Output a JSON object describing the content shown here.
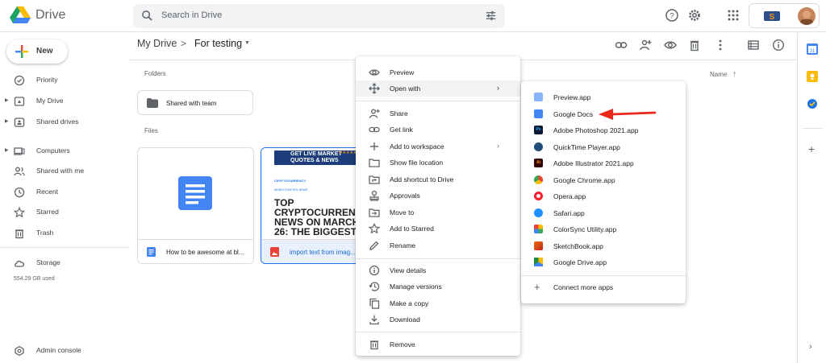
{
  "app": {
    "name": "Drive"
  },
  "search": {
    "placeholder": "Search in Drive"
  },
  "sidebar": {
    "new_label": "New",
    "items": [
      {
        "label": "Priority"
      },
      {
        "label": "My Drive"
      },
      {
        "label": "Shared drives"
      },
      {
        "label": "Computers"
      },
      {
        "label": "Shared with me"
      },
      {
        "label": "Recent"
      },
      {
        "label": "Starred"
      },
      {
        "label": "Trash"
      },
      {
        "label": "Storage"
      }
    ],
    "storage_used": "554.29 GB used",
    "admin_console": "Admin console"
  },
  "breadcrumb": {
    "root": "My Drive",
    "sep": ">",
    "current": "For testing"
  },
  "sections": {
    "folders": "Folders",
    "files": "Files",
    "sort_label": "Name"
  },
  "folders": [
    {
      "name": "Shared with team"
    }
  ],
  "files": [
    {
      "name": "How to be awesome at bl..."
    },
    {
      "name": "import text from imag..."
    }
  ],
  "thumb": {
    "banner": "GET LIVE MARKET QUOTES & NEWS",
    "line1": "CRYPTOCURRENCY",
    "line2": "MONEYCONTROL NEWS",
    "headline": "TOP CRYPTOCURRENCY NEWS ON MARCH 26: THE BIGGEST"
  },
  "context_menu": {
    "items": [
      {
        "label": "Preview",
        "icon": "eye-icon"
      },
      {
        "label": "Open with",
        "icon": "move-icon",
        "submenu": true
      },
      {
        "label": "Share",
        "icon": "person-add-icon"
      },
      {
        "label": "Get link",
        "icon": "link-icon"
      },
      {
        "label": "Add to workspace",
        "icon": "plus-icon",
        "submenu": true
      },
      {
        "label": "Show file location",
        "icon": "folder-icon"
      },
      {
        "label": "Add shortcut to Drive",
        "icon": "shortcut-icon"
      },
      {
        "label": "Approvals",
        "icon": "approval-icon"
      },
      {
        "label": "Move to",
        "icon": "move-to-icon"
      },
      {
        "label": "Add to Starred",
        "icon": "star-icon"
      },
      {
        "label": "Rename",
        "icon": "pencil-icon"
      },
      {
        "label": "View details",
        "icon": "info-icon"
      },
      {
        "label": "Manage versions",
        "icon": "history-icon"
      },
      {
        "label": "Make a copy",
        "icon": "copy-icon"
      },
      {
        "label": "Download",
        "icon": "download-icon"
      },
      {
        "label": "Remove",
        "icon": "trash-icon"
      }
    ]
  },
  "open_with_menu": {
    "items": [
      {
        "label": "Preview.app",
        "color": "#8ab4f8"
      },
      {
        "label": "Google Docs",
        "color": "#4285f4"
      },
      {
        "label": "Adobe Photoshop 2021.app",
        "color": "#0a1a33"
      },
      {
        "label": "QuickTime Player.app",
        "color": "#1f4e79"
      },
      {
        "label": "Adobe Illustrator 2021.app",
        "color": "#330000"
      },
      {
        "label": "Google Chrome.app",
        "color": "#34a853"
      },
      {
        "label": "Opera.app",
        "color": "#ff1b2d"
      },
      {
        "label": "Safari.app",
        "color": "#1e90ff"
      },
      {
        "label": "ColorSync Utility.app",
        "color": "#fbbc04"
      },
      {
        "label": "SketchBook.app",
        "color": "#e8710a"
      },
      {
        "label": "Google Drive.app",
        "color": "#1e8e3e"
      }
    ],
    "connect": "Connect more apps"
  },
  "colors": {
    "accent": "#1a73e8",
    "arrow": "#e8291c"
  }
}
